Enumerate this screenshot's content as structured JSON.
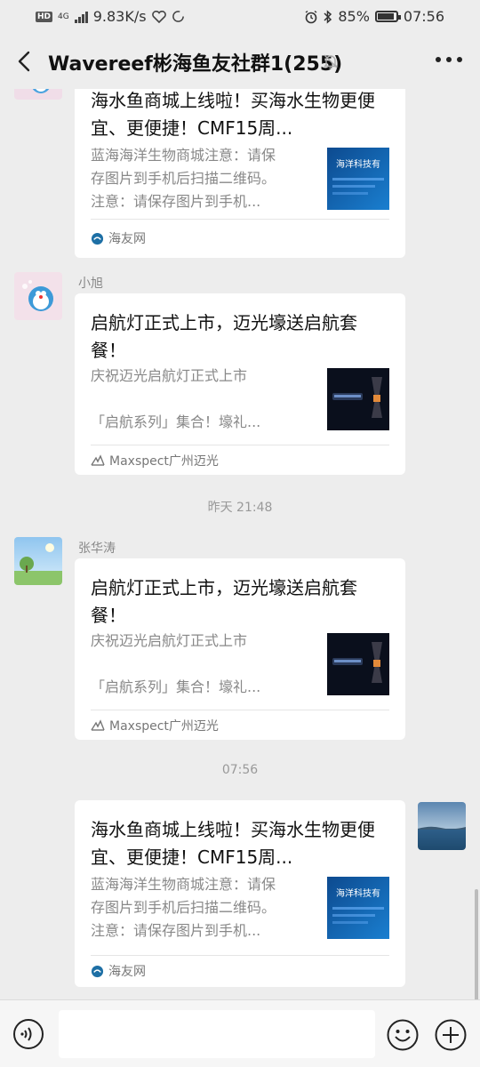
{
  "status_bar": {
    "hd_badge": "HD",
    "network": "4G",
    "speed": "9.83K/s",
    "battery": "85%",
    "time": "07:56"
  },
  "header": {
    "back_icon": "chevron-left-icon",
    "title": "Wavereef彬海鱼友社群1(255)",
    "muted_icon": "bell-off-icon",
    "more_icon": "more-icon"
  },
  "messages": [
    {
      "sender": "",
      "title": "海水鱼商城上线啦！买海水生物更便宜、更便捷！CMF15周...",
      "desc": [
        "蓝海海洋生物商城注意：请保",
        "存图片到手机后扫描二维码。",
        "注意：请保存图片到手机..."
      ],
      "thumb_text": "海洋科技有",
      "source": "海友网"
    },
    {
      "sender": "小旭",
      "title": "启航灯正式上市，迈光壕送启航套餐！",
      "desc": [
        "庆祝迈光启航灯正式上市",
        "",
        "「启航系列」集合！壕礼..."
      ],
      "source": "Maxspect广州迈光"
    },
    {
      "sender": "张华涛",
      "title": "启航灯正式上市，迈光壕送启航套餐！",
      "desc": [
        "庆祝迈光启航灯正式上市",
        "",
        "「启航系列」集合！壕礼..."
      ],
      "source": "Maxspect广州迈光"
    },
    {
      "sender": "",
      "title": "海水鱼商城上线啦！买海水生物更便宜、更便捷！CMF15周...",
      "desc": [
        "蓝海海洋生物商城注意：请保",
        "存图片到手机后扫描二维码。",
        "注意：请保存图片到手机..."
      ],
      "thumb_text": "海洋科技有",
      "source": "海友网"
    }
  ],
  "timestamps": [
    "昨天 21:48",
    "07:56"
  ],
  "input_bar": {
    "voice_icon": "voice-icon",
    "emoji_icon": "emoji-icon",
    "plus_icon": "plus-icon"
  }
}
